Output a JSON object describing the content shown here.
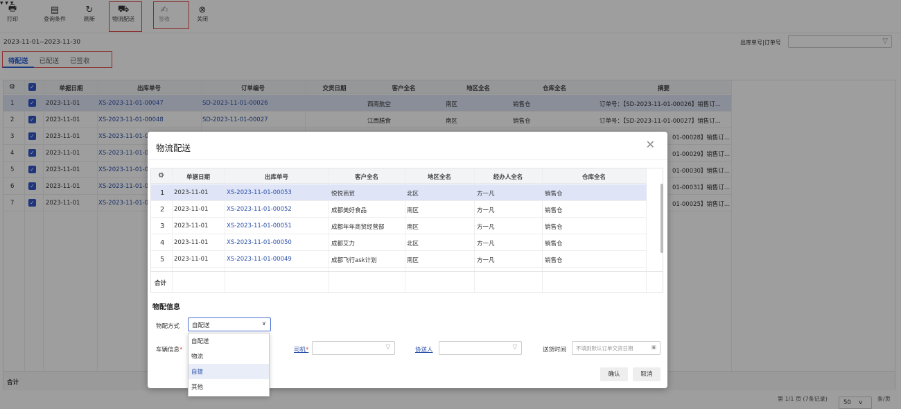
{
  "toolbar": {
    "print": "打印",
    "query": "查询条件",
    "refresh": "刷新",
    "logistics": "物流配送",
    "sign": "签收",
    "close": "关闭"
  },
  "date_range": "2023-11-01--2023-11-30",
  "tabs": [
    "待配送",
    "已配送",
    "已签收"
  ],
  "search": {
    "label": "出库单号|订单号",
    "placeholder": ""
  },
  "grid": {
    "headers": [
      "单据日期",
      "出库单号",
      "订单编号",
      "交货日期",
      "客户全名",
      "地区全名",
      "仓库全名",
      "摘要"
    ],
    "rows": [
      {
        "no": "1",
        "date": "2023-11-01",
        "out": "XS-2023-11-01-00047",
        "order": "SD-2023-11-01-00026",
        "cust": "西南航空",
        "area": "南区",
        "wh": "销售仓",
        "memo": "订单号：【SD-2023-11-01-00026】销售订..."
      },
      {
        "no": "2",
        "date": "2023-11-01",
        "out": "XS-2023-11-01-00048",
        "order": "SD-2023-11-01-00027",
        "cust": "江西膳食",
        "area": "南区",
        "wh": "销售仓",
        "memo": "订单号：【SD-2023-11-01-00027】销售订..."
      },
      {
        "no": "3",
        "date": "2023-11-01",
        "out": "XS-2023-11-01-0",
        "memo": "01-00028】销售订..."
      },
      {
        "no": "4",
        "date": "2023-11-01",
        "out": "XS-2023-11-01-0",
        "memo": "01-00029】销售订..."
      },
      {
        "no": "5",
        "date": "2023-11-01",
        "out": "XS-2023-11-01-0",
        "memo": "01-00030】销售订..."
      },
      {
        "no": "6",
        "date": "2023-11-01",
        "out": "XS-2023-11-01-0",
        "memo": "01-00031】销售订..."
      },
      {
        "no": "7",
        "date": "2023-11-01",
        "out": "XS-2023-11-01-0",
        "memo": "01-00025】销售订..."
      }
    ],
    "footer": "合计"
  },
  "pager": {
    "info": "第 1/1 页 (7条记录)",
    "size": "50",
    "unit": "条/页"
  },
  "modal": {
    "title": "物流配送",
    "headers": [
      "单据日期",
      "出库单号",
      "客户全名",
      "地区全名",
      "经办人全名",
      "仓库全名"
    ],
    "rows": [
      {
        "no": "1",
        "date": "2023-11-01",
        "out": "XS-2023-11-01-00053",
        "cust": "悦悦商贸",
        "area": "北区",
        "op": "方一凡",
        "wh": "销售仓"
      },
      {
        "no": "2",
        "date": "2023-11-01",
        "out": "XS-2023-11-01-00052",
        "cust": "成都美好食品",
        "area": "南区",
        "op": "方一凡",
        "wh": "销售仓"
      },
      {
        "no": "3",
        "date": "2023-11-01",
        "out": "XS-2023-11-01-00051",
        "cust": "成都年年商贸经营部",
        "area": "南区",
        "op": "方一凡",
        "wh": "销售仓"
      },
      {
        "no": "4",
        "date": "2023-11-01",
        "out": "XS-2023-11-01-00050",
        "cust": "成都艾力",
        "area": "北区",
        "op": "方一凡",
        "wh": "销售仓"
      },
      {
        "no": "5",
        "date": "2023-11-01",
        "out": "XS-2023-11-01-00049",
        "cust": "成都飞行ask计划",
        "area": "南区",
        "op": "方一凡",
        "wh": "销售仓"
      }
    ],
    "footer": "合计",
    "section": "物配信息",
    "method_label": "物配方式",
    "method_value": "自配送",
    "options": [
      "自配送",
      "物流",
      "自提",
      "其他"
    ],
    "vehicle_label": "车辆信息",
    "driver_label": "司机",
    "deliverer_label": "协送人",
    "time_label": "送货时间",
    "time_placeholder": "不填则默认订单交货日期",
    "confirm": "确认",
    "cancel": "取消"
  }
}
